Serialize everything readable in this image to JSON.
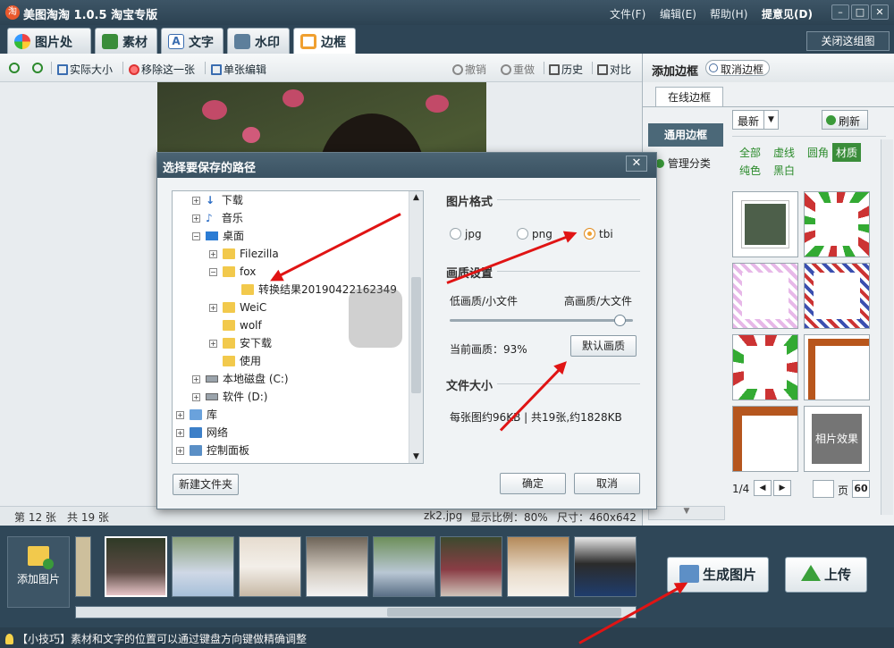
{
  "app": {
    "title": "美图淘淘 1.0.5 淘宝专版"
  },
  "menu": {
    "file": "文件(F)",
    "edit": "编辑(E)",
    "help": "帮助(H)",
    "feedback": "提意见(D)"
  },
  "tabs": [
    {
      "label": "图片处理"
    },
    {
      "label": "素材"
    },
    {
      "label": "文字"
    },
    {
      "label": "水印"
    },
    {
      "label": "边框"
    }
  ],
  "close_group": "关闭这组图",
  "toolbar": {
    "actual_size": "实际大小",
    "remove": "移除这一张",
    "single_edit": "单张编辑",
    "undo": "撤销",
    "redo": "重做",
    "history": "历史",
    "compare": "对比"
  },
  "status": {
    "index": "第 12 张",
    "total": "共 19 张",
    "filename": "zk2.jpg",
    "ratio": "显示比例：80%",
    "size": "尺寸：460x642"
  },
  "right_panel": {
    "title": "添加边框",
    "cancel": "取消边框",
    "online_tab": "在线边框",
    "category": "通用边框",
    "manage": "管理分类",
    "sort": "最新",
    "refresh": "刷新",
    "filters": [
      "全部",
      "虚线",
      "圆角",
      "材质",
      "纯色",
      "黑白"
    ],
    "thumb_label": "相片效果",
    "page": "1/4",
    "page_unit": "页",
    "page_size": "60"
  },
  "filmstrip": {
    "add": "添加图片",
    "generate": "生成图片",
    "upload": "上传"
  },
  "tip": "【小技巧】素材和文字的位置可以通过键盘方向键做精确调整",
  "dialog": {
    "title": "选择要保存的路径",
    "tree": [
      {
        "label": "下载"
      },
      {
        "label": "音乐"
      },
      {
        "label": "桌面"
      },
      {
        "label": "Filezilla"
      },
      {
        "label": "fox"
      },
      {
        "label": "转换结果20190422162349"
      },
      {
        "label": "WeiC"
      },
      {
        "label": "wolf"
      },
      {
        "label": "安下载"
      },
      {
        "label": "使用"
      },
      {
        "label": "本地磁盘 (C:)"
      },
      {
        "label": "软件 (D:)"
      },
      {
        "label": "库"
      },
      {
        "label": "网络"
      },
      {
        "label": "控制面板"
      }
    ],
    "format_title": "图片格式",
    "formats": [
      "jpg",
      "png",
      "tbi"
    ],
    "quality_title": "画质设置",
    "quality_low": "低画质/小文件",
    "quality_high": "高画质/大文件",
    "quality_current": "当前画质：93%",
    "quality_value": 0.93,
    "default_quality": "默认画质",
    "filesize_title": "文件大小",
    "filesize_text": "每张图约96KB | 共19张,约1828KB",
    "new_folder": "新建文件夹",
    "ok": "确定",
    "cancel": "取消"
  },
  "colors": {
    "accent_red": "#e01414",
    "titlebar": "#2e4556"
  }
}
